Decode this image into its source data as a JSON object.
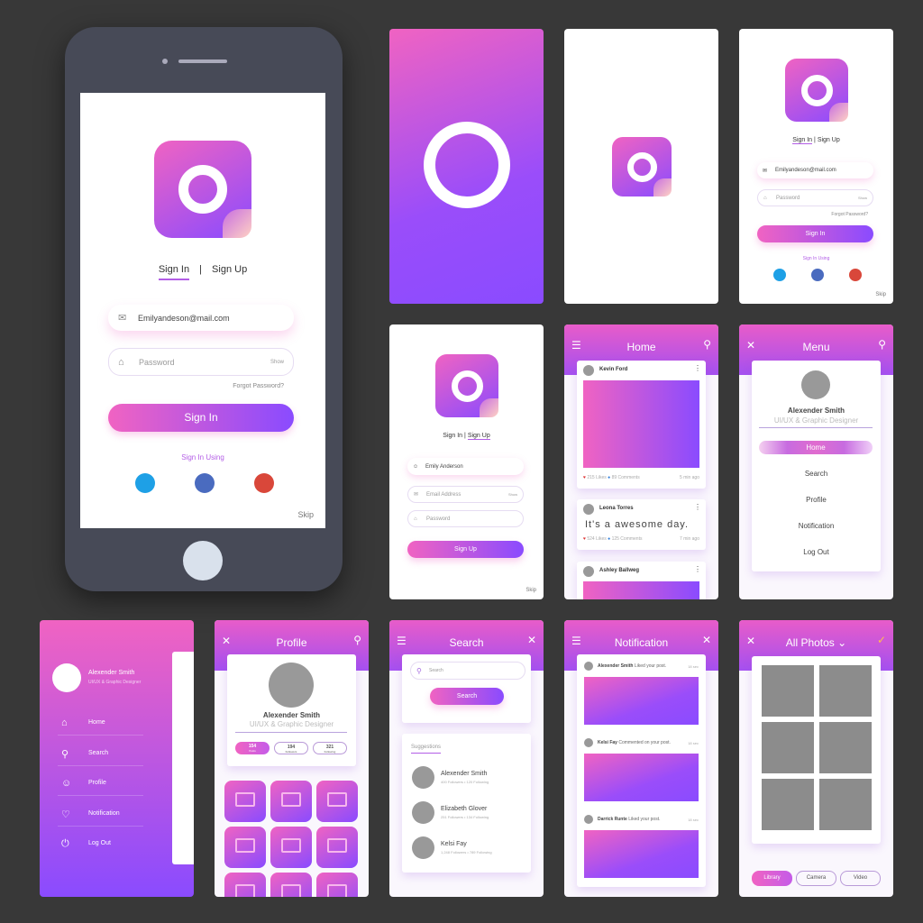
{
  "colors": {
    "bg": "#383838",
    "gradient_start": "#f063c2",
    "gradient_end": "#8a4bff",
    "social": [
      "#1ea0e6",
      "#4a6bbf",
      "#d9473a"
    ]
  },
  "auth": {
    "sign_in": "Sign In",
    "separator": "|",
    "sign_up": "Sign Up",
    "email": "Emilyandeson@mail.com",
    "password_placeholder": "Password",
    "show": "Show",
    "forgot": "Forgot Password?",
    "sign_in_button": "Sign In",
    "sign_in_using": "Sign In Using",
    "skip": "Skip"
  },
  "signup": {
    "name": "Emily Anderson",
    "email_placeholder": "Email Address",
    "show": "Show",
    "password_placeholder": "Password",
    "button": "Sign Up"
  },
  "home": {
    "title": "Home",
    "posts": [
      {
        "user": "Kevin Ford",
        "likes": "215 Likes",
        "comments": "89 Comments",
        "time": "5 min ago"
      },
      {
        "user": "Leona Torres",
        "text": "It's a awesome day.",
        "likes": "524 Likes",
        "comments": "125 Comments",
        "time": "7 min ago"
      },
      {
        "user": "Ashley Ballweg"
      }
    ]
  },
  "menu": {
    "title": "Menu",
    "name": "Alexender Smith",
    "role": "UI/UX & Graphic Designer",
    "items": [
      "Home",
      "Search",
      "Profile",
      "Notification",
      "Log Out"
    ]
  },
  "sidebar": {
    "name": "Alexender Smith",
    "role": "UI/UX & Graphic Designer",
    "items": [
      {
        "label": "Home",
        "icon": "home-icon",
        "glyph": "⌂"
      },
      {
        "label": "Search",
        "icon": "search-icon",
        "glyph": "⚲"
      },
      {
        "label": "Profile",
        "icon": "user-icon",
        "glyph": "☺"
      },
      {
        "label": "Notification",
        "icon": "heart-icon",
        "glyph": "♡"
      },
      {
        "label": "Log Out",
        "icon": "power-icon",
        "glyph": "⏻"
      }
    ]
  },
  "profile": {
    "title": "Profile",
    "name": "Alexender Smith",
    "role": "UI/UX & Graphic Designer",
    "stats": [
      {
        "value": "154",
        "label": "Posts"
      },
      {
        "value": "194",
        "label": "Followers"
      },
      {
        "value": "321",
        "label": "Following"
      }
    ]
  },
  "search": {
    "title": "Search",
    "placeholder": "Search",
    "button": "Search",
    "suggestions_label": "Suggestions",
    "users": [
      {
        "name": "Alexender Smith",
        "meta": "400 Followers • 120 Following"
      },
      {
        "name": "Elizabeth Glover",
        "meta": "251 Followers • 134 Following"
      },
      {
        "name": "Kelsi Fay",
        "meta": "1,248 Followers • 789 Following"
      }
    ]
  },
  "notification": {
    "title": "Notification",
    "items": [
      {
        "user": "Alexender Smith",
        "action": "Liked your post.",
        "time": "18 sec"
      },
      {
        "user": "Kelsi Fay",
        "action": "Commented on your post.",
        "time": "18 sec"
      },
      {
        "user": "Darrick Runte",
        "action": "Liked your post.",
        "time": "18 sec"
      }
    ]
  },
  "photos": {
    "title": "All Photos",
    "tabs": [
      "Library",
      "Camera",
      "Video"
    ]
  }
}
